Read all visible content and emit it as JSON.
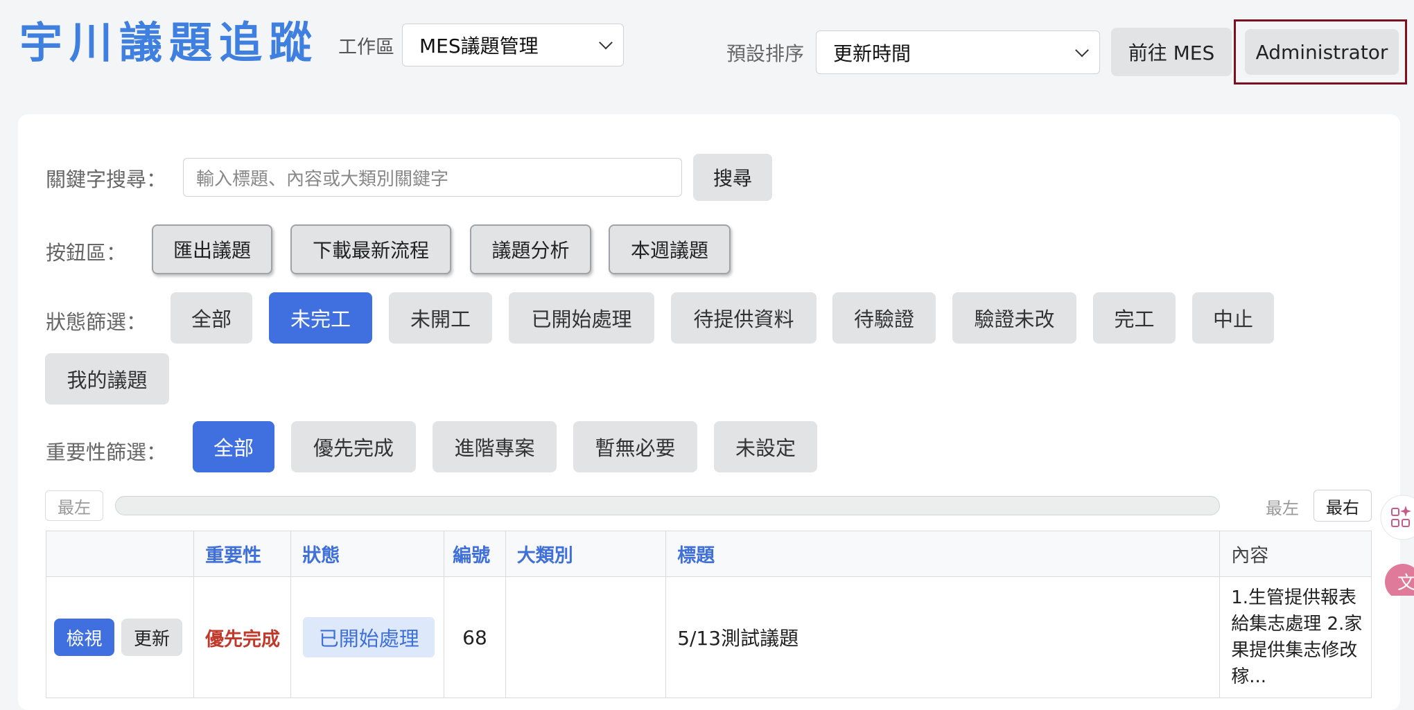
{
  "header": {
    "app_title": "宇川議題追蹤",
    "workspace_label": "工作區",
    "workspace_value": "MES議題管理",
    "sort_label": "預設排序",
    "sort_value": "更新時間",
    "goto_mes": "前往 MES",
    "user": "Administrator"
  },
  "search": {
    "label": "關鍵字搜尋：",
    "placeholder": "輸入標題、內容或大類別關鍵字",
    "button": "搜尋"
  },
  "actions": {
    "label": "按鈕區：",
    "buttons": [
      "匯出議題",
      "下載最新流程",
      "議題分析",
      "本週議題"
    ]
  },
  "status_filter": {
    "label": "狀態篩選：",
    "options": [
      "全部",
      "未完工",
      "未開工",
      "已開始處理",
      "待提供資料",
      "待驗證",
      "驗證未改",
      "完工",
      "中止",
      "我的議題"
    ],
    "selected": "未完工"
  },
  "priority_filter": {
    "label": "重要性篩選：",
    "options": [
      "全部",
      "優先完成",
      "進階專案",
      "暫無必要",
      "未設定"
    ],
    "selected": "全部"
  },
  "scroll": {
    "left_btn": "最左",
    "left_label": "最左",
    "right_btn": "最右"
  },
  "table": {
    "headers": [
      "",
      "重要性",
      "狀態",
      "編號",
      "大類別",
      "標題",
      "內容"
    ],
    "rows": [
      {
        "view": "檢視",
        "update": "更新",
        "priority": "優先完成",
        "status": "已開始處理",
        "number": "68",
        "category": "",
        "title": "5/13測試議題",
        "content": "1.生管提供報表給集志處理 2.家果提供集志修改稼..."
      }
    ]
  },
  "colors": {
    "accent": "#4070e0",
    "title_blue": "#3f7fe0",
    "priority_red": "#c0392b",
    "admin_outline": "#7a1020"
  }
}
